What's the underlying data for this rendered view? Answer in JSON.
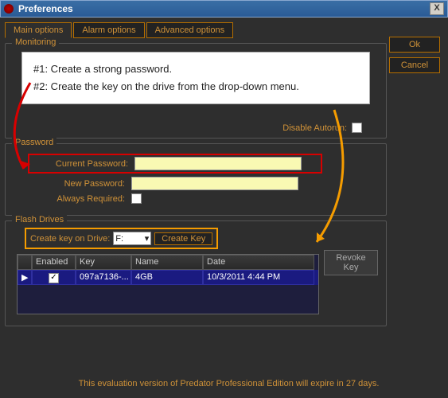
{
  "window": {
    "title": "Preferences",
    "close": "X"
  },
  "buttons": {
    "ok": "Ok",
    "cancel": "Cancel",
    "createKey": "Create Key",
    "revokeKey": "Revoke Key"
  },
  "tabs": {
    "main": "Main options",
    "alarm": "Alarm options",
    "advanced": "Advanced options"
  },
  "callout": {
    "line1": "#1: Create a strong password.",
    "line2": "#2: Create the key on the drive from the drop-down menu."
  },
  "sections": {
    "monitoring": "Monitoring",
    "password": "Password",
    "flash": "Flash Drives"
  },
  "labels": {
    "disableAutorun": "Disable Autorun:",
    "currentPassword": "Current Password:",
    "newPassword": "New Password:",
    "alwaysRequired": "Always Required:",
    "createKeyOnDrive": "Create key on Drive:",
    "driveSel": "F:"
  },
  "grid": {
    "headers": {
      "enabled": "Enabled",
      "key": "Key",
      "name": "Name",
      "date": "Date"
    },
    "row": {
      "enabled": "✓",
      "key": "097a7136-...",
      "name": "4GB",
      "date": "10/3/2011 4:44 PM"
    }
  },
  "footer": "This evaluation version of Predator Professional Edition will expire in 27 days."
}
